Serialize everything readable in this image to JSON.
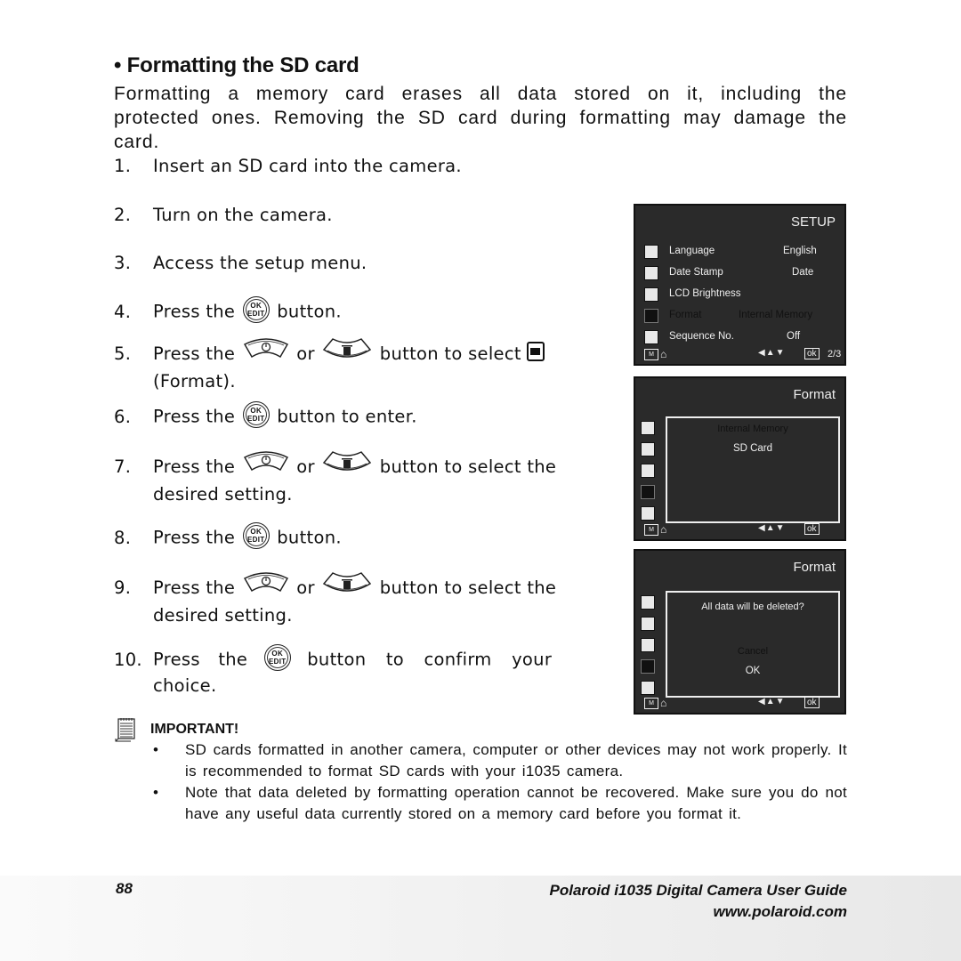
{
  "heading": "• Formatting the SD card",
  "intro": "Formatting a memory card erases all data stored on it, including the protected ones. Removing the SD card during formatting may damage the card.",
  "icons": {
    "ok_button": {
      "line1": "OK",
      "line2": "EDIT"
    }
  },
  "steps": [
    {
      "num": "1.",
      "text": "Insert an SD card into the camera."
    },
    {
      "num": "2.",
      "text": "Turn on the camera."
    },
    {
      "num": "3.",
      "text": "Access the setup menu."
    },
    {
      "num": "4.",
      "pre": "Press the",
      "post": "button."
    },
    {
      "num": "5.",
      "pre": "Press the",
      "mid": "or",
      "post": "button to select",
      "cont": "(Format)."
    },
    {
      "num": "6.",
      "pre": "Press the",
      "post": "button to enter."
    },
    {
      "num": "7.",
      "pre": "Press the",
      "mid": "or",
      "post": "button to select the",
      "cont": "desired setting."
    },
    {
      "num": "8.",
      "pre": "Press the",
      "post": "button."
    },
    {
      "num": "9.",
      "pre": "Press the",
      "mid": "or",
      "post": "button to select the",
      "cont": "desired setting."
    },
    {
      "num": "10.",
      "pre": "Press the",
      "post": "button to confirm your",
      "cont": "choice."
    }
  ],
  "screens": {
    "setup": {
      "title": "SETUP",
      "rows": [
        {
          "label": "Language",
          "value": "English"
        },
        {
          "label": "Date Stamp",
          "value": "Date"
        },
        {
          "label": "LCD Brightness",
          "value": ""
        },
        {
          "label": "Format",
          "value": "Internal Memory"
        },
        {
          "label": "Sequence No.",
          "value": "Off"
        }
      ],
      "bottom": {
        "m": "M",
        "arrows": "◀▲▼",
        "ok": "ok",
        "page": "2/3"
      }
    },
    "format_select": {
      "title": "Format",
      "options": [
        "Internal Memory",
        "SD Card"
      ],
      "bottom": {
        "m": "M",
        "arrows": "◀▲▼",
        "ok": "ok"
      }
    },
    "format_confirm": {
      "title": "Format",
      "prompt": "All data will be deleted?",
      "options": [
        "Cancel",
        "OK"
      ],
      "bottom": {
        "m": "M",
        "arrows": "◀▲▼",
        "ok": "ok"
      }
    }
  },
  "important": {
    "title": "IMPORTANT!",
    "bullets": [
      "SD cards formatted in another camera, computer or other devices may not work properly. It is recommended to format SD cards with your i1035 camera.",
      "Note that data deleted by formatting operation cannot be recovered. Make sure you do not have any useful data currently stored on a memory card before you format it."
    ]
  },
  "footer": {
    "page_number": "88",
    "guide_title": "Polaroid i1035 Digital Camera User Guide",
    "website": "www.polaroid.com"
  }
}
